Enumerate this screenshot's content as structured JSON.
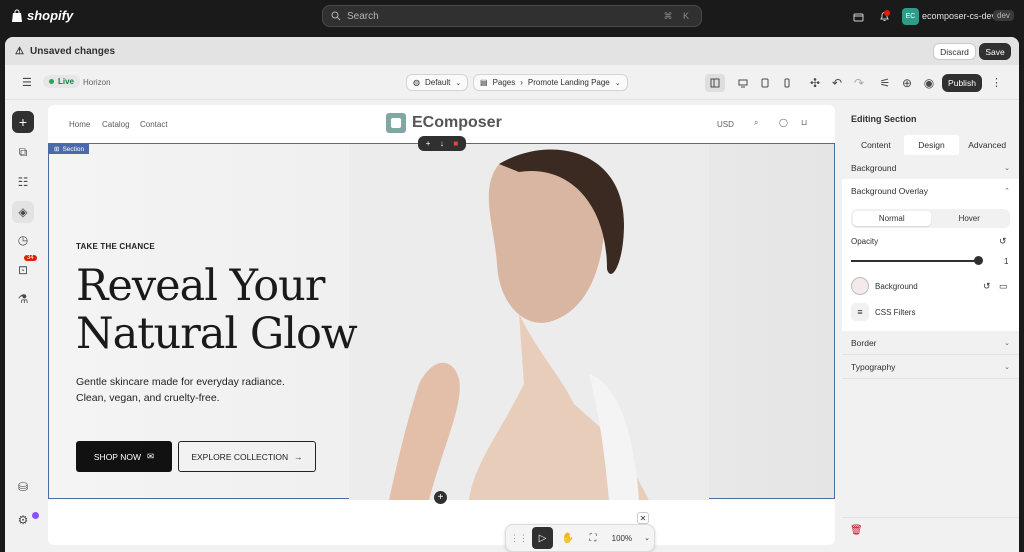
{
  "topbar": {
    "brand": "shopify",
    "search_placeholder": "Search",
    "search_shortcut": "⌘ K",
    "store_initials": "EC",
    "store_name": "ecomposer-cs-dev",
    "store_badge": "dev"
  },
  "unsaved": {
    "message": "Unsaved changes",
    "discard_label": "Discard",
    "save_label": "Save"
  },
  "editor_toolbar": {
    "live_label": "Live",
    "theme_name": "Horizon",
    "template_select": "Default",
    "pages_label": "Pages",
    "page_name": "Promote Landing Page",
    "publish_label": "Publish"
  },
  "left_rail": {
    "badge_count": "34"
  },
  "site": {
    "nav": [
      "Home",
      "Catalog",
      "Contact"
    ],
    "brand": "EComposer",
    "currency": "USD",
    "section_tag": "Section",
    "eyebrow": "TAKE THE CHANCE",
    "headline_line1": "Reveal Your",
    "headline_line2": "Natural Glow",
    "subcopy_line1": "Gentle skincare made for everyday radiance.",
    "subcopy_line2": "Clean, vegan, and cruelty-free.",
    "shop_label": "SHOP NOW",
    "explore_label": "EXPLORE COLLECTION"
  },
  "zoom": {
    "level": "100%"
  },
  "panel": {
    "title": "Editing Section",
    "tabs": [
      "Content",
      "Design",
      "Advanced"
    ],
    "active_tab": "Design",
    "background_label": "Background",
    "overlay_label": "Background Overlay",
    "state_tabs": [
      "Normal",
      "Hover"
    ],
    "opacity_label": "Opacity",
    "opacity_value": "1",
    "overlay_background_label": "Background",
    "css_filters_label": "CSS Filters",
    "border_label": "Border",
    "typography_label": "Typography"
  },
  "colors": {
    "accent_dark": "#303030",
    "section_outline": "#4b6ba8",
    "live_green": "#29a35a",
    "danger": "#c1121f"
  }
}
